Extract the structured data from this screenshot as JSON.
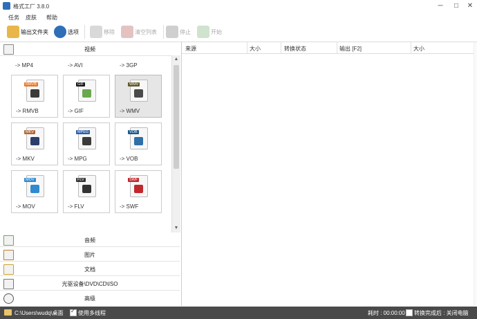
{
  "window": {
    "title": "格式工厂 3.8.0",
    "minimize": "─",
    "maximize": "□",
    "close": "✕"
  },
  "menu": [
    "任务",
    "皮肤",
    "帮助"
  ],
  "toolbar": {
    "output_folder": "输出文件夹",
    "options": "选项",
    "remove": "移除",
    "clear_list": "清空列表",
    "stop": "停止",
    "start": "开始"
  },
  "left": {
    "video_category": "视频",
    "top_partial": [
      "-> MP4",
      "-> AVI",
      "-> 3GP"
    ],
    "tiles": [
      {
        "label": "-> RMVB",
        "tag": "RMVB",
        "tag_color": "#e87722",
        "pic_color": "#3b3b3b",
        "icon": "rmvb-file-icon"
      },
      {
        "label": "-> GIF",
        "tag": "GIF",
        "tag_color": "#1a1a1a",
        "pic_color": "#6aa84f",
        "icon": "gif-file-icon"
      },
      {
        "label": "-> WMV",
        "tag": "WMV",
        "tag_color": "#5f5a2a",
        "pic_color": "#4a4a4a",
        "icon": "wmv-file-icon",
        "selected": true
      },
      {
        "label": "-> MKV",
        "tag": "MKV",
        "tag_color": "#b06a3b",
        "pic_color": "#2b3f6b",
        "icon": "mkv-file-icon"
      },
      {
        "label": "-> MPG",
        "tag": "MPEG",
        "tag_color": "#2b5ea8",
        "pic_color": "#3b3b3b",
        "icon": "mpg-file-icon"
      },
      {
        "label": "-> VOB",
        "tag": "VOB",
        "tag_color": "#1f5a8a",
        "pic_color": "#2f6fa8",
        "icon": "vob-file-icon"
      },
      {
        "label": "-> MOV",
        "tag": "MOV",
        "tag_color": "#2f8ad0",
        "pic_color": "#2f8ad0",
        "icon": "mov-file-icon"
      },
      {
        "label": "-> FLV",
        "tag": "FLV",
        "tag_color": "#333333",
        "pic_color": "#333333",
        "icon": "flv-file-icon"
      },
      {
        "label": "-> SWF",
        "tag": "SWF",
        "tag_color": "#c0282d",
        "pic_color": "#c0282d",
        "icon": "swf-file-icon"
      }
    ],
    "categories": [
      "音频",
      "图片",
      "文档",
      "光驱设备\\DVD\\CD\\ISO",
      "高级"
    ]
  },
  "columns": [
    "来源",
    "大小",
    "转换状态",
    "输出 [F2]",
    "大小"
  ],
  "status": {
    "path": "C:\\Users\\wudq\\桌面",
    "multithread": "使用多线程",
    "elapsed": "耗时 : 00:00:00",
    "after_convert": "转换完成后 : 关闭电脑"
  }
}
